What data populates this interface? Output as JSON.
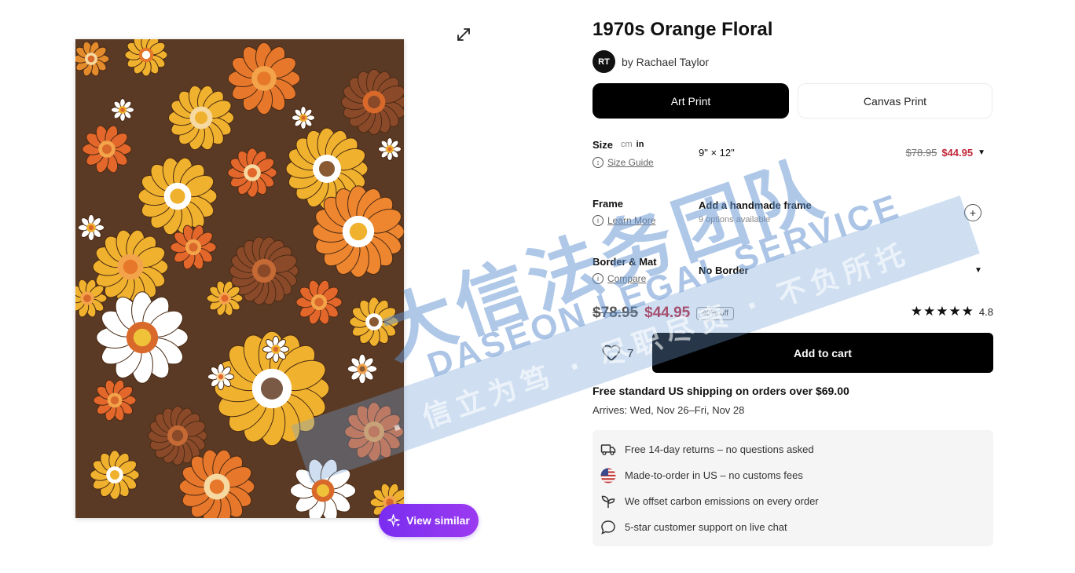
{
  "product": {
    "title": "1970s Orange Floral",
    "artist_initials": "RT",
    "artist": "by Rachael Taylor"
  },
  "formats": [
    {
      "label": "Art Print",
      "selected": true
    },
    {
      "label": "Canvas Print",
      "selected": false
    }
  ],
  "options": {
    "size": {
      "label": "Size",
      "unit_cm": "cm",
      "unit_in": "in",
      "guide": "Size Guide",
      "value": "9\" × 12\"",
      "price_old": "$78.95",
      "price_new": "$44.95"
    },
    "frame": {
      "label": "Frame",
      "link": "Learn More",
      "value": "Add a handmade frame",
      "note": "9 options available"
    },
    "border": {
      "label": "Border & Mat",
      "link": "Compare",
      "value": "No Border"
    }
  },
  "pricing": {
    "old": "$78.95",
    "new": "$44.95",
    "discount": "40% off",
    "rating": "4.8",
    "stars": "★★★★★"
  },
  "wishlist_count": "7",
  "add_to_cart": "Add to cart",
  "view_similar": "View similar",
  "shipping": {
    "free_text": "Free standard US shipping on orders over $69.00",
    "arrives": "Arrives: Wed, Nov 26–Fri, Nov 28"
  },
  "perks": [
    {
      "icon": "truck-return-icon",
      "text": "Free 14-day returns – no questions asked"
    },
    {
      "icon": "us-flag-icon",
      "text": "Made-to-order in US – no customs fees"
    },
    {
      "icon": "sprout-icon",
      "text": "We offset carbon emissions on every order"
    },
    {
      "icon": "chat-bubble-icon",
      "text": "5-star customer support on live chat"
    }
  ],
  "watermark": {
    "brand_cn": "大信法务团队",
    "brand_en": "DASEON LEGAL SERVICE",
    "motto": "· 信立为笃 · 尽职尽责 · 不负所托"
  }
}
